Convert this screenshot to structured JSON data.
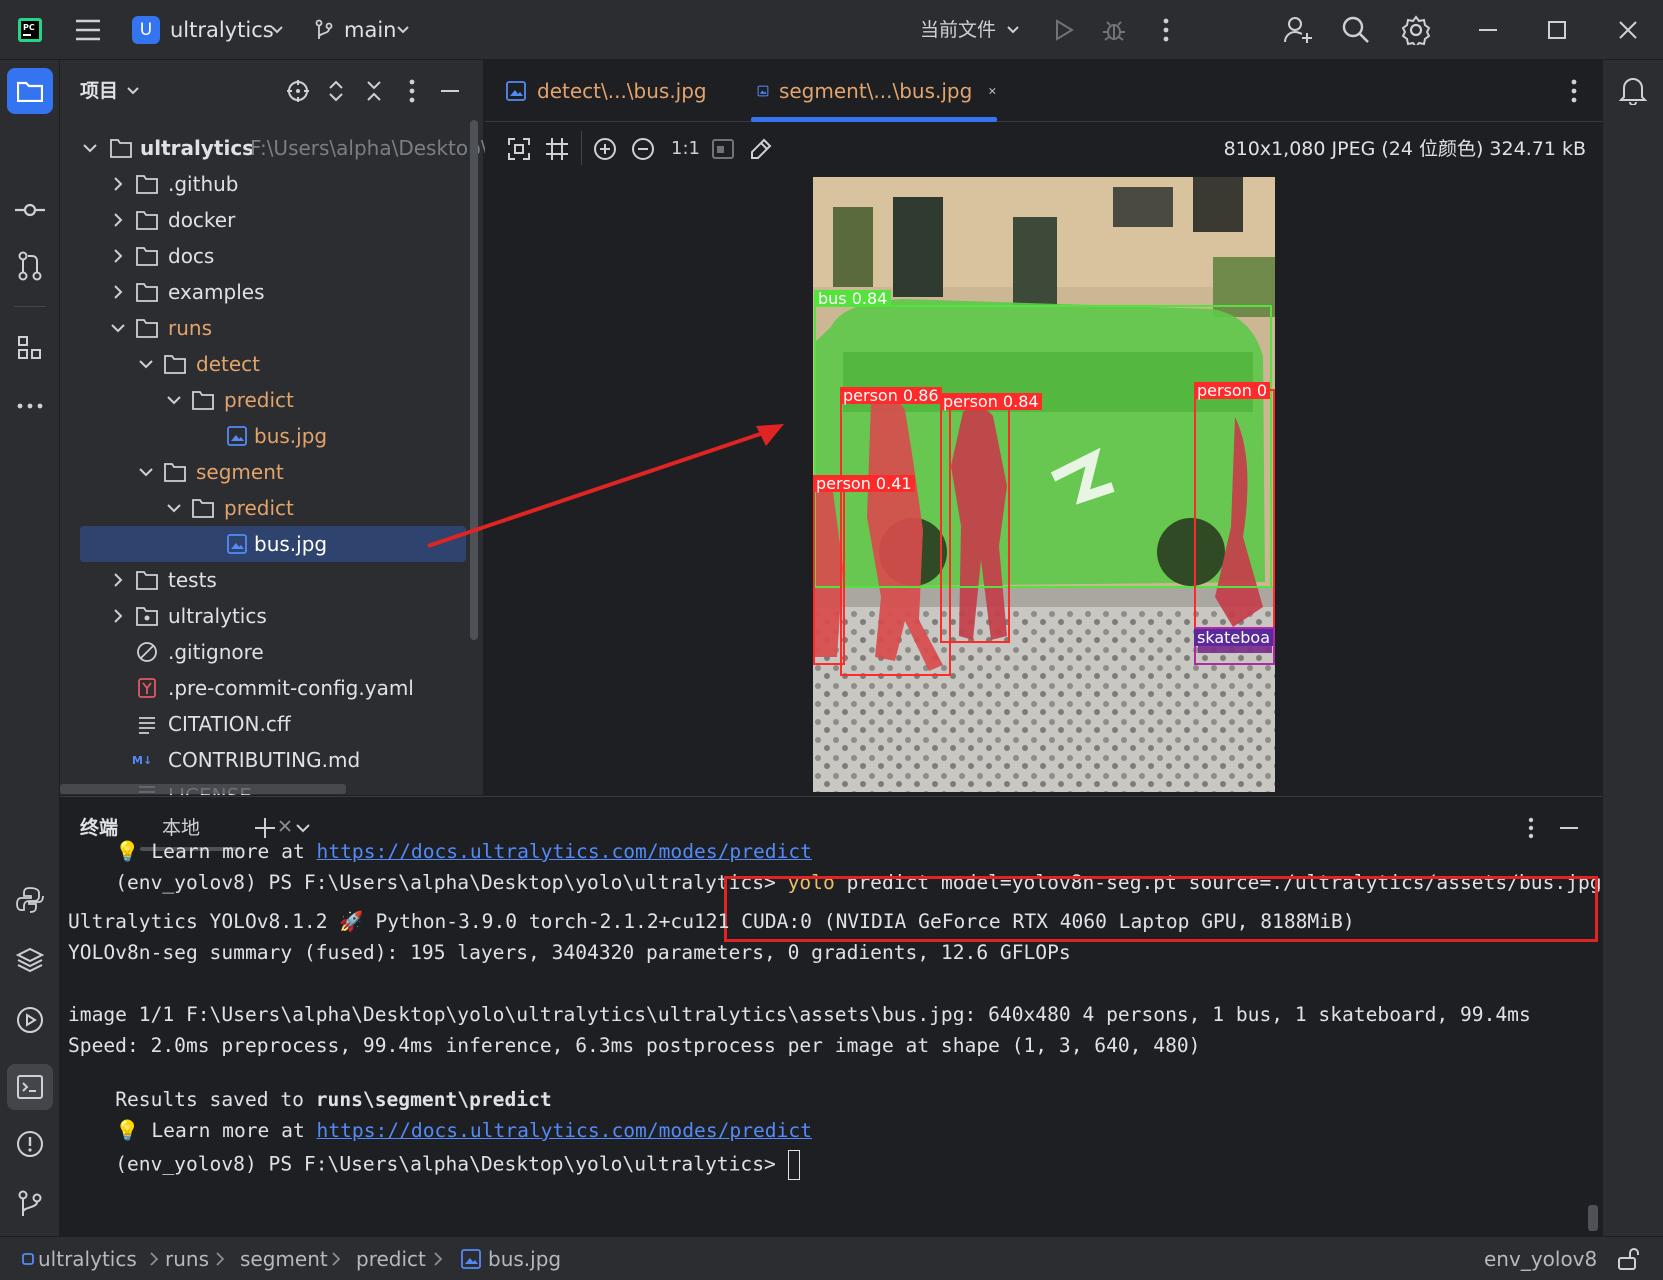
{
  "titlebar": {
    "project_avatar": "U",
    "project_name": "ultralytics",
    "branch": "main",
    "run_config": "当前文件"
  },
  "project_panel": {
    "title": "项目",
    "root_name": "ultralytics",
    "root_path": "F:\\Users\\alpha\\Desktop\\y",
    "items": [
      {
        "label": ".github"
      },
      {
        "label": "docker"
      },
      {
        "label": "docs"
      },
      {
        "label": "examples"
      },
      {
        "label": "runs"
      },
      {
        "label": "detect"
      },
      {
        "label": "predict"
      },
      {
        "label": "bus.jpg"
      },
      {
        "label": "segment"
      },
      {
        "label": "predict"
      },
      {
        "label": "bus.jpg"
      },
      {
        "label": "tests"
      },
      {
        "label": "ultralytics"
      },
      {
        "label": ".gitignore"
      },
      {
        "label": ".pre-commit-config.yaml"
      },
      {
        "label": "CITATION.cff"
      },
      {
        "label": "CONTRIBUTING.md"
      },
      {
        "label": "LICENSE"
      }
    ]
  },
  "editor": {
    "tabs": [
      {
        "label": "detect\\...\\bus.jpg"
      },
      {
        "label": "segment\\...\\bus.jpg"
      }
    ],
    "zoom_actual": "1:1",
    "image_info": "810x1,080 JPEG (24 位颜色) 324.71 kB",
    "detections": [
      {
        "label": "bus 0.84"
      },
      {
        "label": "person 0.86"
      },
      {
        "label": "person 0.84"
      },
      {
        "label": "person 0"
      },
      {
        "label": "person 0.41"
      },
      {
        "label": "skateboa"
      }
    ]
  },
  "terminal": {
    "title": "终端",
    "tab_local": "本地",
    "lines": {
      "l1_prefix": "💡 Learn more at ",
      "l1_link": "https://docs.ultralytics.com/modes/predict",
      "l2_prompt": "(env_yolov8) PS F:\\Users\\alpha\\Desktop\\yolo\\ultralytics> ",
      "l2_cmd": "yolo",
      "l2_args": " predict model=yolov8n-seg.pt source=./ultralytics/assets/bus.jpg",
      "l3": "Ultralytics YOLOv8.1.2 🚀 Python-3.9.0 torch-2.1.2+cu121 CUDA:0 (NVIDIA GeForce RTX 4060 Laptop GPU, 8188MiB)",
      "l4": "YOLOv8n-seg summary (fused): 195 layers, 3404320 parameters, 0 gradients, 12.6 GFLOPs",
      "l5": "image 1/1 F:\\Users\\alpha\\Desktop\\yolo\\ultralytics\\ultralytics\\assets\\bus.jpg: 640x480 4 persons, 1 bus, 1 skateboard, 99.4ms",
      "l6": "Speed: 2.0ms preprocess, 99.4ms inference, 6.3ms postprocess per image at shape (1, 3, 640, 480)",
      "l7_prefix": "Results saved to ",
      "l7_bold": "runs\\segment\\predict",
      "l8_prefix": "💡 Learn more at ",
      "l8_link": "https://docs.ultralytics.com/modes/predict",
      "l9_prompt": "(env_yolov8) PS F:\\Users\\alpha\\Desktop\\yolo\\ultralytics> "
    }
  },
  "statusbar": {
    "breadcrumbs": [
      "ultralytics",
      "runs",
      "segment",
      "predict",
      "bus.jpg"
    ],
    "interpreter": "env_yolov8"
  },
  "colors": {
    "accent": "#3574f0",
    "selected_row": "#2e436e",
    "annotation_red": "#e02424",
    "mask_green": "#5ec84a",
    "mask_red": "#d84c4c"
  }
}
